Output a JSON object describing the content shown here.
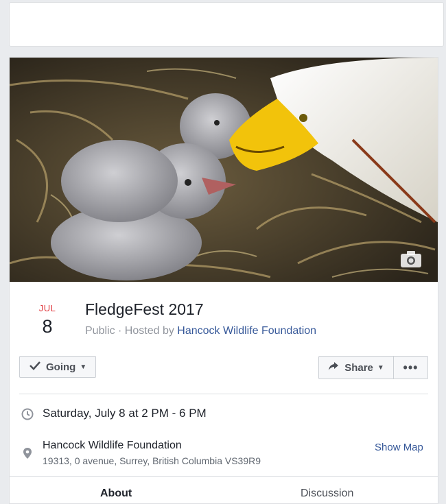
{
  "event": {
    "cover_alt_icon": "camera-icon",
    "date": {
      "month": "JUL",
      "day": "8"
    },
    "title": "FledgeFest 2017",
    "privacy": "Public",
    "hosted_prefix": " · Hosted by ",
    "host": "Hancock Wildlife Foundation"
  },
  "actions": {
    "going_label": "Going",
    "share_label": "Share",
    "more_label": "•••"
  },
  "details": {
    "time": "Saturday, July 8 at 2 PM - 6 PM",
    "location_name": "Hancock Wildlife Foundation",
    "location_address": "19313, 0 avenue, Surrey, British Columbia VS39R9",
    "show_map_label": "Show Map"
  },
  "tabs": [
    {
      "label": "About"
    },
    {
      "label": "Discussion"
    }
  ],
  "colors": {
    "month": "#e0393e",
    "link": "#365899",
    "muted": "#90949c"
  }
}
